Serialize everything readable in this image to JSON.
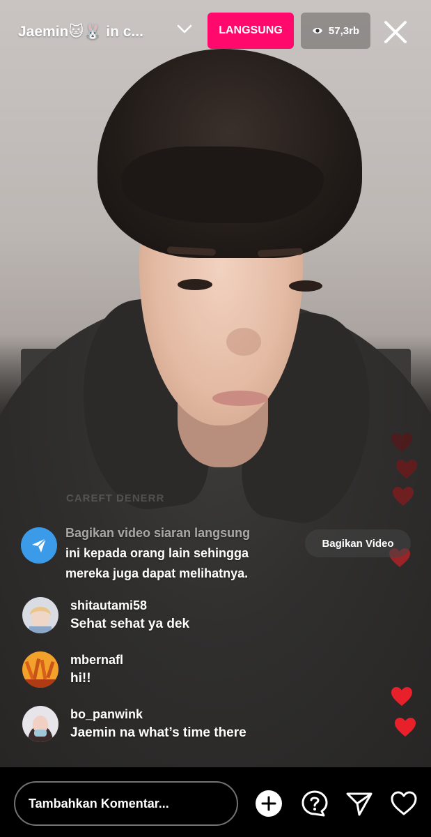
{
  "header": {
    "title": "Jaemin🐱🐰 in c...",
    "live_label": "LANGSUNG",
    "viewer_count": "57,3rb"
  },
  "share_prompt": {
    "line1": "Bagikan video siaran langsung",
    "line2": "ini kepada orang lain sehingga",
    "line3": "mereka juga dapat melihatnya.",
    "button_label": "Bagikan Video",
    "faded_text": "CAREFT DENERR"
  },
  "comments": [
    {
      "username": "shitautami58",
      "text": "Sehat sehat ya dek"
    },
    {
      "username": "mbernafl",
      "text": "hi!!"
    },
    {
      "username": "bo_panwink",
      "text": "Jaemin na what’s time there"
    }
  ],
  "footer": {
    "comment_placeholder": "Tambahkan Komentar..."
  },
  "colors": {
    "live_badge": "#ff0a6c",
    "share_icon_bg": "#3b9be9",
    "heart": "#e8202a"
  }
}
